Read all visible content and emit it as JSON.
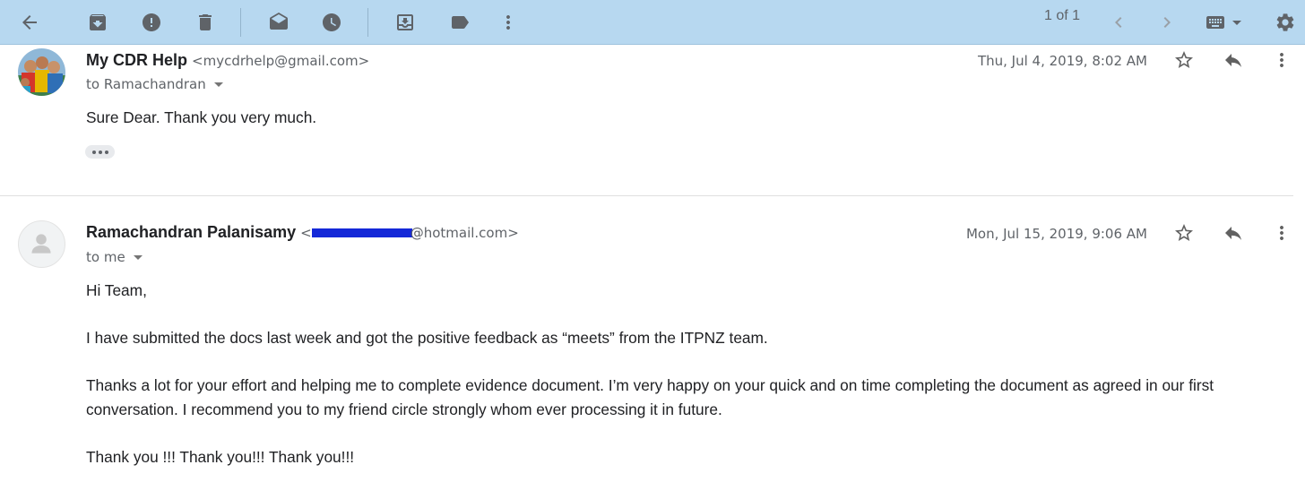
{
  "toolbar": {
    "icons": [
      "back-arrow-icon",
      "archive-icon",
      "report-spam-icon",
      "delete-icon",
      "mark-unread-icon",
      "snooze-icon",
      "move-to-icon",
      "label-icon",
      "more-vert-icon",
      "older-icon",
      "newer-icon",
      "keyboard-icon",
      "settings-icon"
    ],
    "pager": "1 of 1"
  },
  "messages": [
    {
      "sender_name": "My CDR Help",
      "sender_email": "<mycdrhelp@gmail.com>",
      "to": "to Ramachandran",
      "date": "Thu, Jul 4, 2019, 8:02 AM",
      "body": [
        "Sure Dear. Thank you very much."
      ],
      "show_trimmed": true
    },
    {
      "sender_name": "Ramachandran Palanisamy",
      "sender_email_prefix": "<",
      "sender_email_suffix": "@hotmail.com>",
      "to": "to me",
      "date": "Mon, Jul 15, 2019, 9:06 AM",
      "body": [
        "Hi Team,",
        "I have submitted the docs last week and got the positive feedback as “meets” from the ITPNZ team.",
        "Thanks a lot for your effort and helping me to complete evidence document. I’m very happy on your quick and on time completing the document as agreed in our first conversation. I recommend you to my friend circle strongly whom ever processing it in future.",
        "Thank you !!! Thank you!!! Thank you!!!"
      ]
    }
  ],
  "colors": {
    "toolbar_bg": "#b7d8f0",
    "redaction": "#1428d8"
  }
}
